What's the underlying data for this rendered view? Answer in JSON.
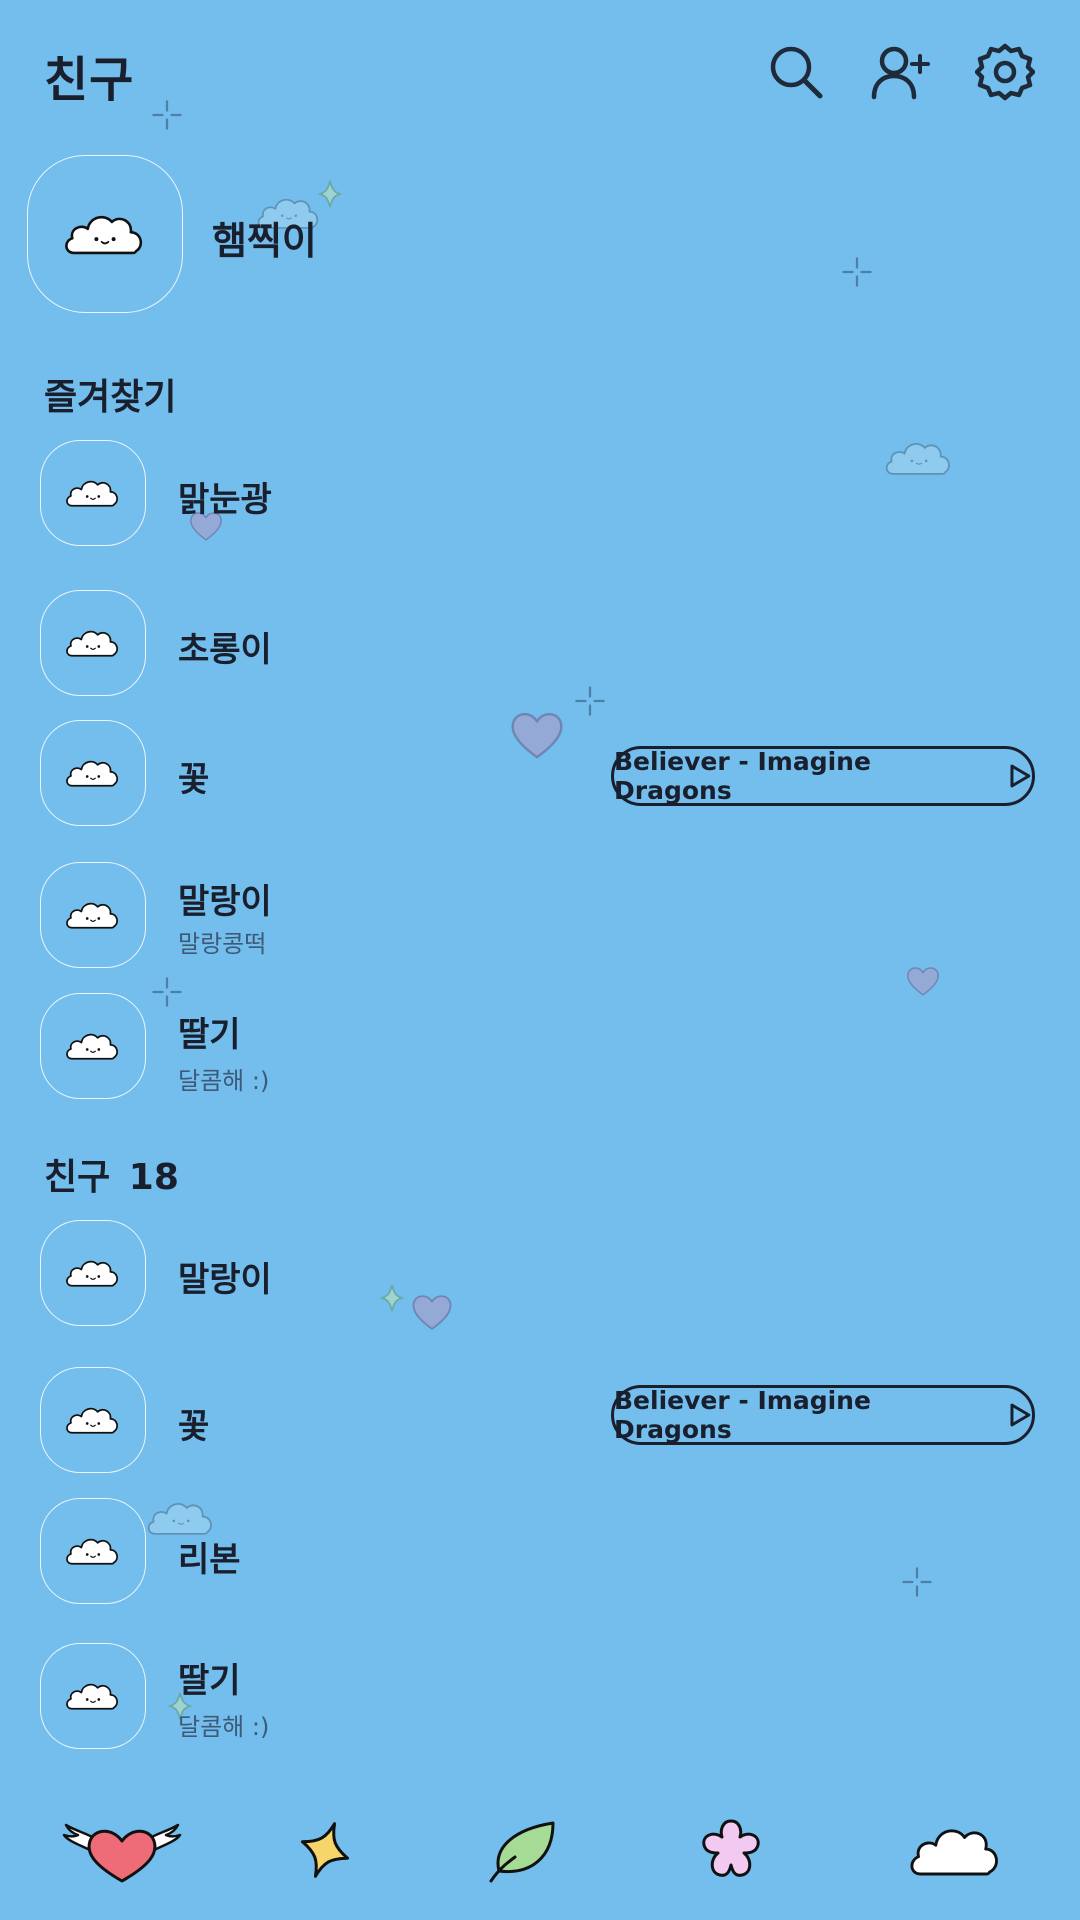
{
  "header": {
    "title": "친구",
    "icons": [
      "search-icon",
      "add-friend-icon",
      "settings-icon"
    ]
  },
  "profile": {
    "name": "햄찍이"
  },
  "favorites": {
    "title": "즐겨찾기",
    "items": [
      {
        "name": "맑눈광",
        "status": "",
        "music": ""
      },
      {
        "name": "초롱이",
        "status": "",
        "music": ""
      },
      {
        "name": "꽃",
        "status": "",
        "music": "Believer - Imagine Dragons"
      },
      {
        "name": "말랑이",
        "status": "말랑콩떡",
        "music": ""
      },
      {
        "name": "딸기",
        "status": "달콤해 :)",
        "music": ""
      }
    ]
  },
  "friends": {
    "title": "친구",
    "count": "18",
    "items": [
      {
        "name": "말랑이",
        "status": "",
        "music": ""
      },
      {
        "name": "꽃",
        "status": "",
        "music": "Believer - Imagine Dragons"
      },
      {
        "name": "리본",
        "status": "",
        "music": ""
      },
      {
        "name": "딸기",
        "status": "달콤해 :)",
        "music": ""
      }
    ]
  },
  "tabbar": {
    "tabs": [
      "heart-wings-icon",
      "star-icon",
      "leaf-icon",
      "flower-icon",
      "cloud-icon"
    ]
  },
  "colors": {
    "background": "#73BEEC",
    "text": "#1a1f2e",
    "status": "#3f5a78"
  }
}
